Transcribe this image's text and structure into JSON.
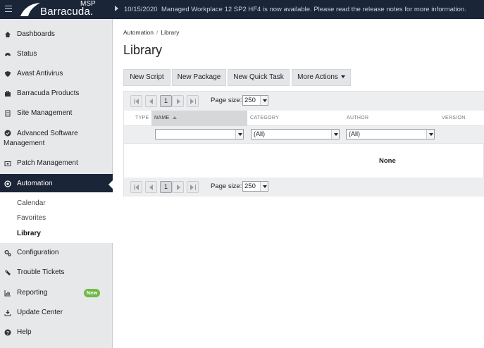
{
  "brand": {
    "logo_msp": "MSP",
    "logo_name": "Barracuda."
  },
  "notice": {
    "date": "10/15/2020",
    "text": "Managed Workplace 12 SP2 HF4 is now available. Please read the release notes for more information."
  },
  "sidebar": {
    "items": [
      {
        "label": "Dashboards",
        "icon": "home-icon"
      },
      {
        "label": "Status",
        "icon": "gauge-icon"
      },
      {
        "label": "Avast Antivirus",
        "icon": "shield-icon"
      },
      {
        "label": "Barracuda Products",
        "icon": "briefcase-icon"
      },
      {
        "label": "Site Management",
        "icon": "building-icon"
      },
      {
        "label": "Advanced Software",
        "label2": "Management",
        "icon": "check-circle-icon"
      },
      {
        "label": "Patch Management",
        "icon": "first-aid-icon"
      },
      {
        "label": "Automation",
        "icon": "target-icon",
        "active": true
      },
      {
        "label": "Configuration",
        "icon": "gears-icon"
      },
      {
        "label": "Trouble Tickets",
        "icon": "ticket-icon"
      },
      {
        "label": "Reporting",
        "icon": "bar-chart-icon"
      },
      {
        "label": "Update Center",
        "icon": "download-icon",
        "badge": "New"
      },
      {
        "label": "Help",
        "icon": "question-icon"
      }
    ],
    "sub_items": [
      "Calendar",
      "Favorites",
      "Library"
    ]
  },
  "breadcrumb": {
    "parent": "Automation",
    "sep": "/",
    "current": "Library"
  },
  "page_title": "Library",
  "toolbar": {
    "new_script": "New Script",
    "new_package": "New Package",
    "new_quick_task": "New Quick Task",
    "more_actions": "More Actions"
  },
  "grid": {
    "pager": {
      "current_page": "1",
      "page_size_label": "Page size:",
      "page_size": "250"
    },
    "columns": [
      "TYPE",
      "NAME",
      "CATEGORY",
      "AUTHOR",
      "VERSION"
    ],
    "filters": {
      "name": "",
      "category": "(All)",
      "author": "(All)"
    },
    "empty_text": "None"
  },
  "colors": {
    "topbar": "#1b2538",
    "sidebar": "#e6e8ea",
    "accent_badge": "#72b846"
  }
}
